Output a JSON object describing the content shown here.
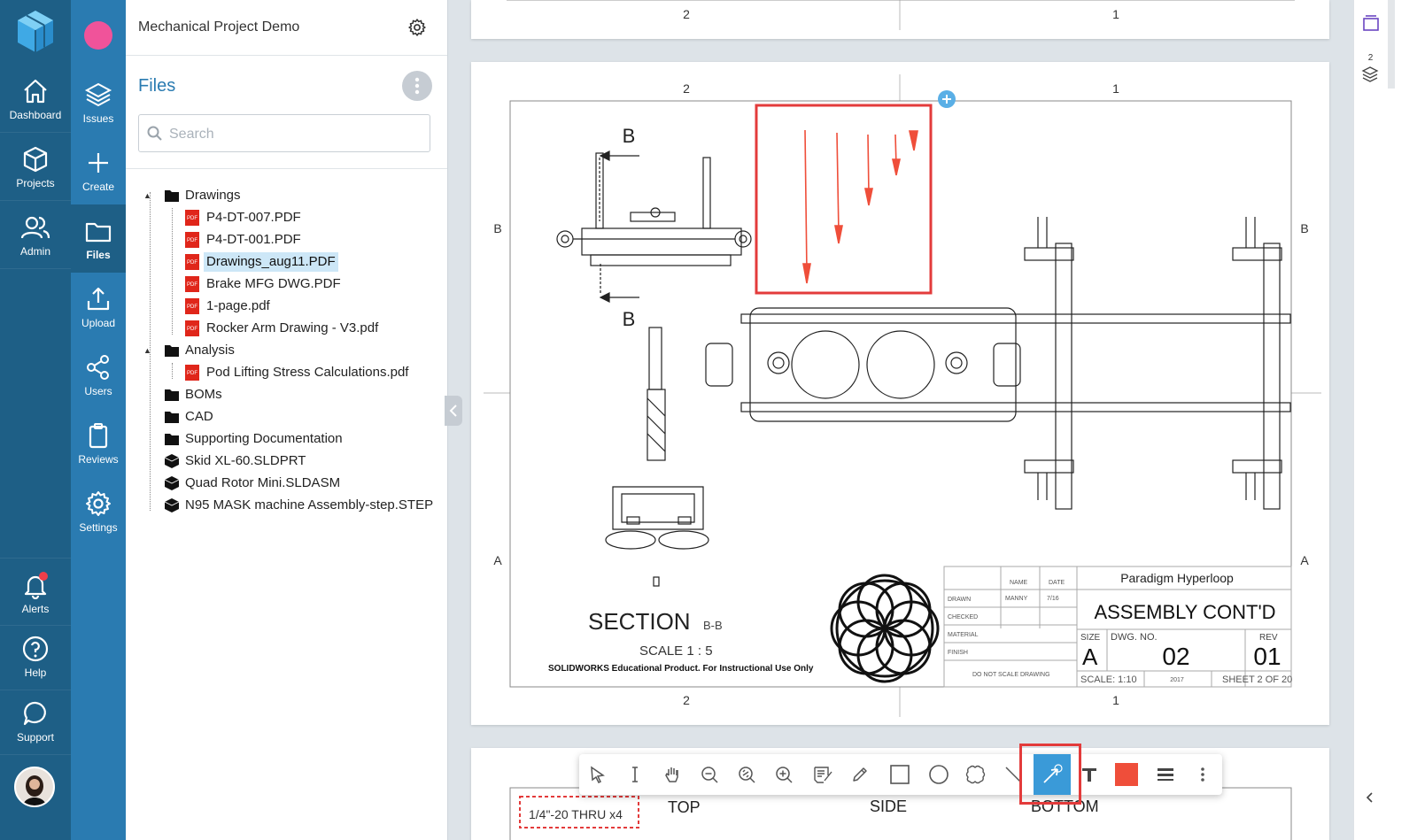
{
  "nav": {
    "dashboard": "Dashboard",
    "projects": "Projects",
    "admin": "Admin",
    "alerts": "Alerts",
    "help": "Help",
    "support": "Support"
  },
  "subnav": {
    "issues": "Issues",
    "create": "Create",
    "files": "Files",
    "upload": "Upload",
    "users": "Users",
    "reviews": "Reviews",
    "settings": "Settings"
  },
  "panel": {
    "project_name": "Mechanical Project Demo",
    "title": "Files",
    "search_placeholder": "Search"
  },
  "tree": [
    {
      "label": "Drawings",
      "kind": "folder"
    },
    {
      "label": "P4-DT-007.PDF",
      "kind": "pdf"
    },
    {
      "label": "P4-DT-001.PDF",
      "kind": "pdf"
    },
    {
      "label": "Drawings_aug11.PDF",
      "kind": "pdf",
      "selected": true
    },
    {
      "label": "Brake MFG DWG.PDF",
      "kind": "pdf"
    },
    {
      "label": "1-page.pdf",
      "kind": "pdf"
    },
    {
      "label": "Rocker Arm Drawing - V3.pdf",
      "kind": "pdf"
    },
    {
      "label": "Analysis",
      "kind": "folder"
    },
    {
      "label": "Pod Lifting Stress Calculations.pdf",
      "kind": "pdf"
    },
    {
      "label": "BOMs",
      "kind": "folder"
    },
    {
      "label": "CAD",
      "kind": "folder"
    },
    {
      "label": "Supporting Documentation",
      "kind": "folder"
    },
    {
      "label": "Skid XL-60.SLDPRT",
      "kind": "cad"
    },
    {
      "label": "Quad Rotor Mini.SLDASM",
      "kind": "cad"
    },
    {
      "label": "N95 MASK machine Assembly-step.STEP",
      "kind": "cad"
    }
  ],
  "pdf_icon_text": "PDF",
  "drawing": {
    "zone_2": "2",
    "zone_1": "1",
    "zone_b": "B",
    "zone_a": "A",
    "section_letter": "B",
    "section_title": "SECTION",
    "section_suffix": "B-B",
    "scale_label": "SCALE 1 : 5",
    "edu_note": "SOLIDWORKS Educational Product. For Instructional Use Only",
    "company": "Paradigm Hyperloop",
    "title": "ASSEMBLY CONT'D",
    "tb_name": "NAME",
    "tb_date": "DATE",
    "tb_drawn": "DRAWN",
    "tb_drawn_name": "MANNY",
    "tb_drawn_date": "7/16",
    "tb_checked": "CHECKED",
    "tb_material": "MATERIAL",
    "tb_finish": "FINISH",
    "tb_dnsd": "DO NOT SCALE DRAWING",
    "size_label": "SIZE",
    "size_value": "A",
    "dwg_label": "DWG.  NO.",
    "dwg_value": "02",
    "rev_label": "REV",
    "rev_value": "01",
    "scale_tb": "SCALE: 1:10",
    "year": "2017",
    "sheet": "SHEET 2 OF 20"
  },
  "next_sheet": {
    "callout": "1/4\"-20 THRU x4",
    "top": "TOP",
    "side": "SIDE",
    "bottom": "BOTTOM"
  },
  "rail": {
    "layers_count": "2"
  },
  "colors": {
    "nav_dark": "#1e5f86",
    "nav_light": "#2a7bb1",
    "accent": "#3a9ad8",
    "highlight": "#e33b3b",
    "markup": "#ef4e3a",
    "pink": "#f0539a"
  }
}
